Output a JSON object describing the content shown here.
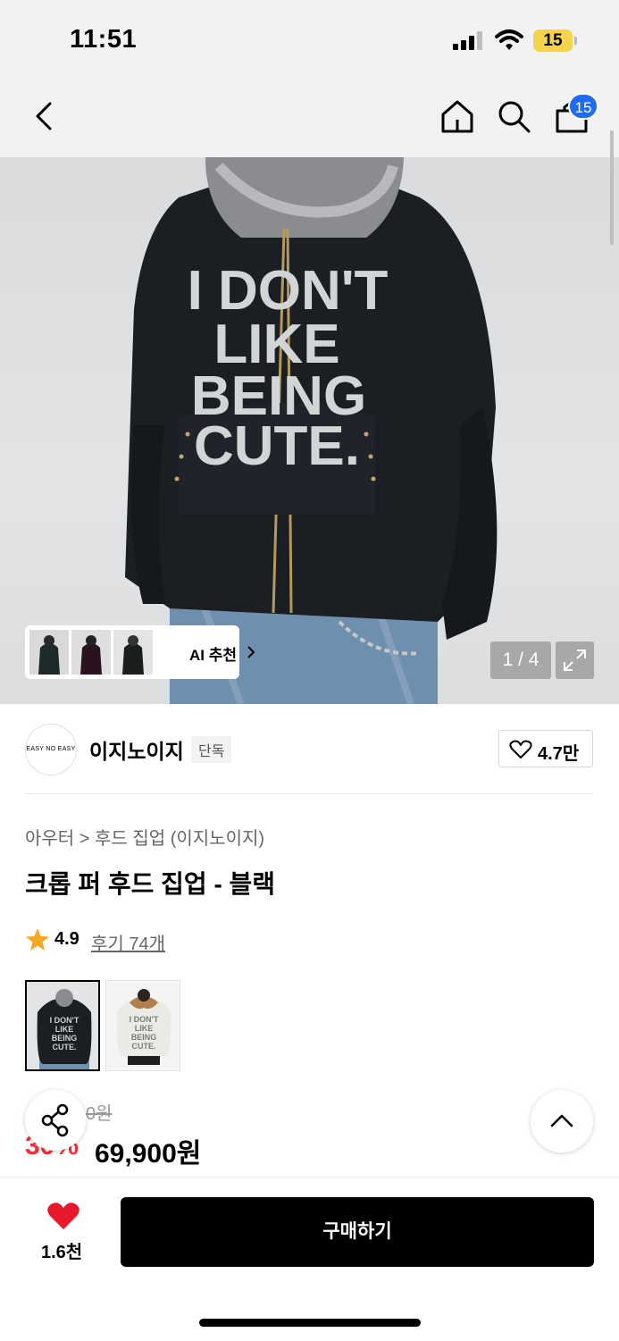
{
  "status_bar": {
    "time": "11:51",
    "battery": "15"
  },
  "nav": {
    "cart_count": "15"
  },
  "hero": {
    "print_lines": [
      "I DON'T",
      "LIKE",
      "BEING",
      "CUTE."
    ],
    "ai_label": "AI 추천",
    "pager": "1 / 4"
  },
  "brand": {
    "logo_text": "EASY NO EASY",
    "name": "이지노이지",
    "badge": "단독",
    "likes": "4.7만"
  },
  "product": {
    "breadcrumb": "아우터 > 후드 집업 (이지노이지)",
    "title": "크롭 퍼 후드 집업 - 블랙",
    "rating": "4.9",
    "reviews": "후기 74개",
    "original_price_fragment": "0원",
    "discount": "30%",
    "price": "69,900원"
  },
  "bottom_bar": {
    "heart_count": "1.6천",
    "buy_label": "구매하기"
  },
  "colors": {
    "accent_blue": "#1f6cf2",
    "discount_red": "#f0303a",
    "heart_red": "#e8172b",
    "star": "#f5a623"
  }
}
